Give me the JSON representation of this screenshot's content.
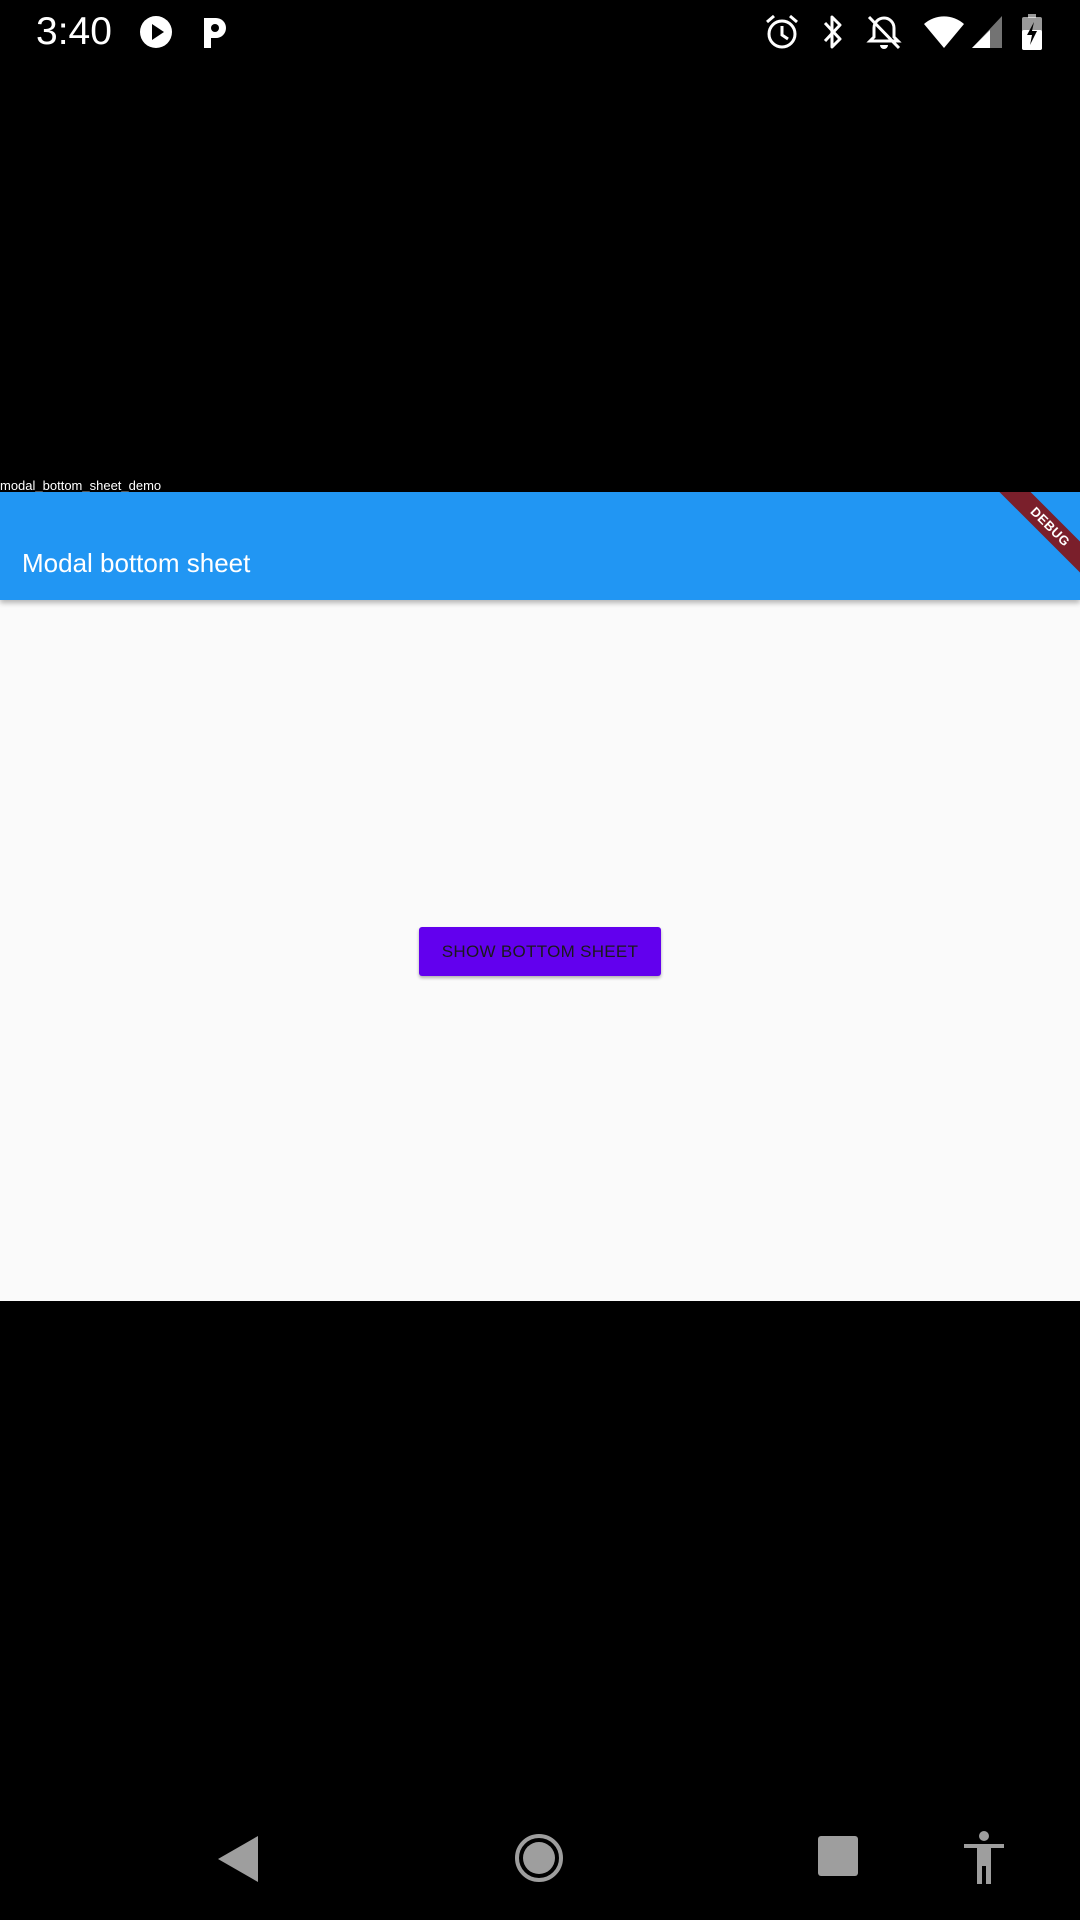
{
  "status_bar": {
    "time": "3:40",
    "left_icons": [
      "play-circle-icon",
      "parking-p-icon"
    ],
    "right_icons": [
      "alarm-clock-icon",
      "bluetooth-icon",
      "notifications-off-icon",
      "wifi-icon",
      "cellular-signal-icon",
      "battery-charging-icon"
    ]
  },
  "app": {
    "label": "modal_bottom_sheet_demo",
    "title": "Modal bottom sheet",
    "debug_banner": "DEBUG",
    "show_button_label": "SHOW BOTTOM SHEET",
    "colors": {
      "app_bar": "#2196f3",
      "button": "#6200ee",
      "body": "#fafafa",
      "debug_banner": "#7a1f2b"
    }
  },
  "nav_bar": {
    "icons": [
      "back-icon",
      "home-icon",
      "recents-icon",
      "accessibility-icon"
    ]
  }
}
